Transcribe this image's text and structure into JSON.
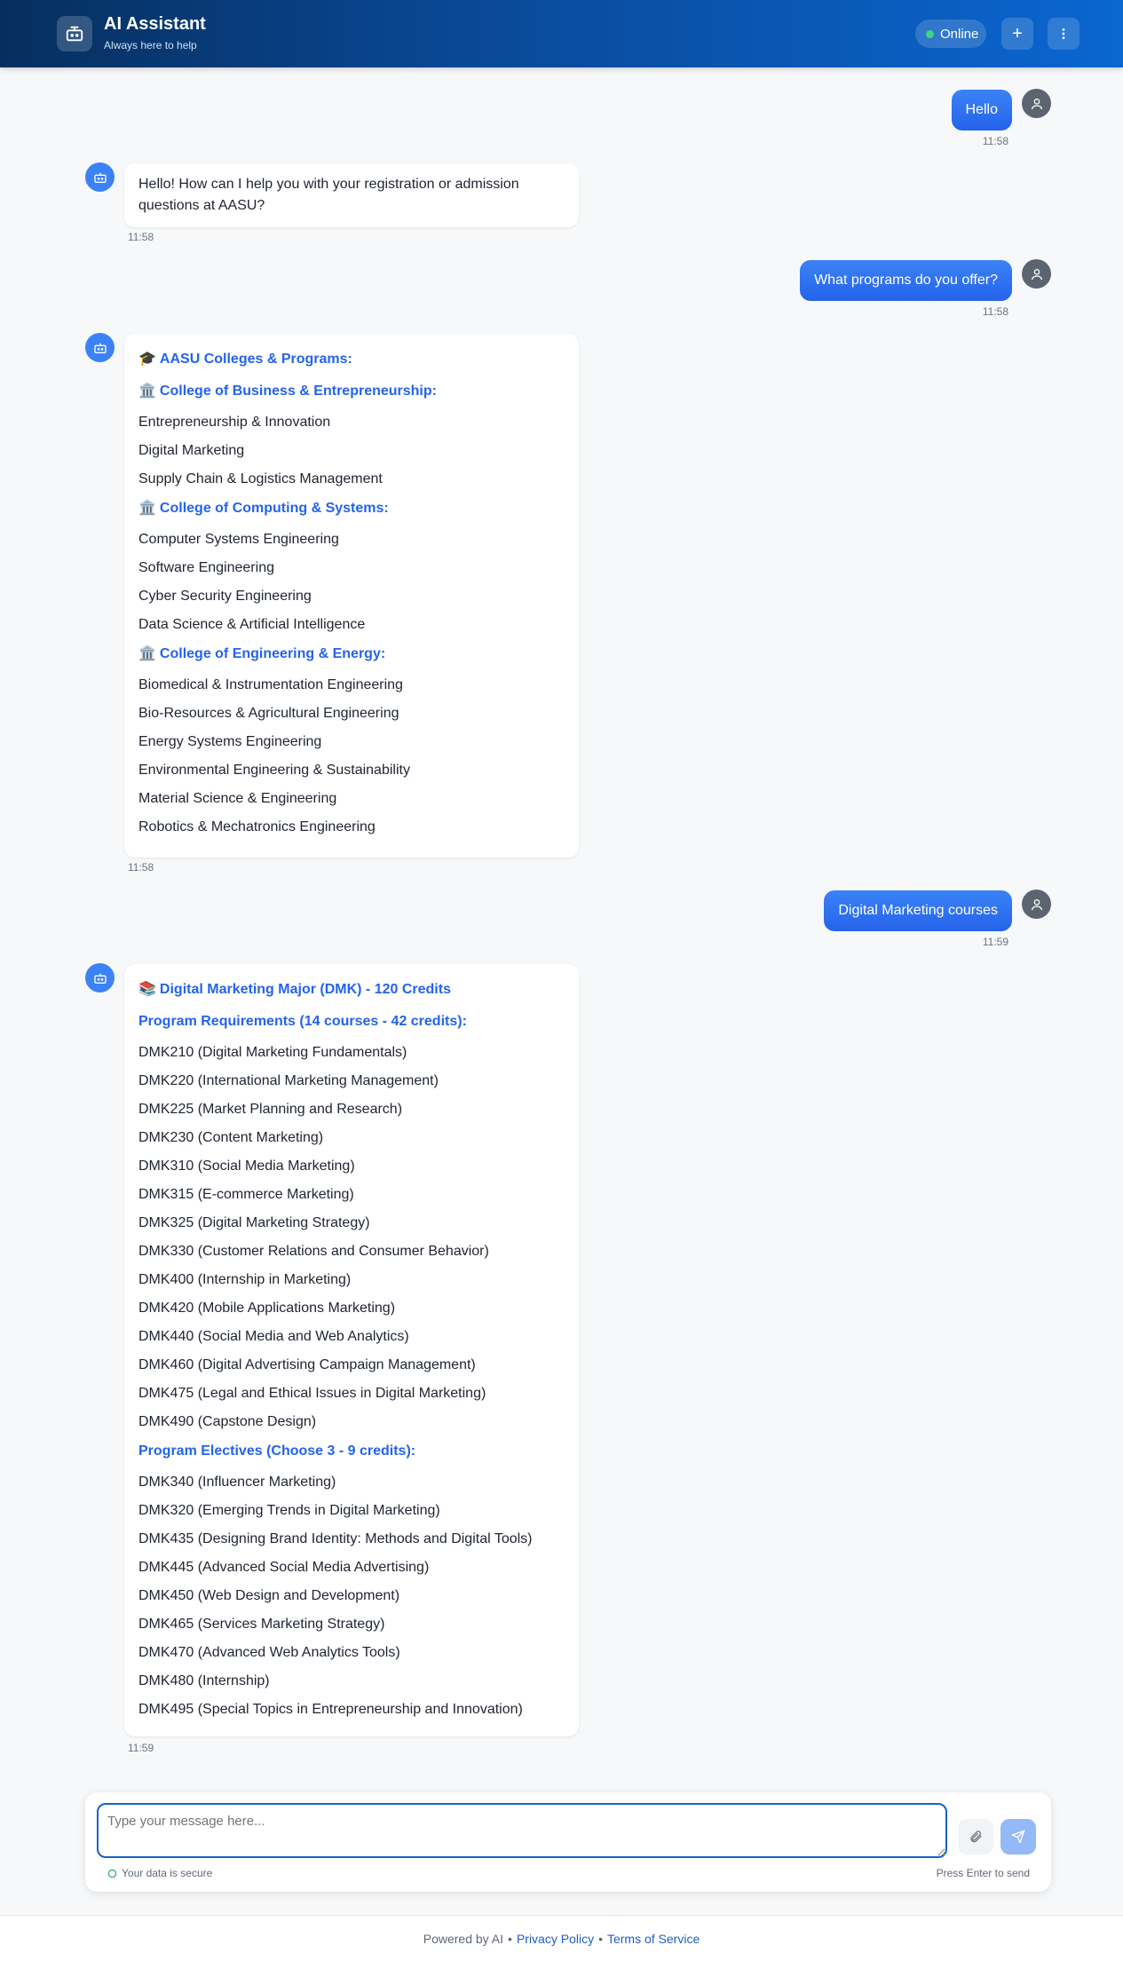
{
  "header": {
    "title": "AI Assistant",
    "subtitle": "Always here to help",
    "status": "Online",
    "new_chat_icon": "plus-icon",
    "menu_icon": "more-vertical-icon"
  },
  "messages": [
    {
      "role": "user",
      "text": "Hello",
      "time": "11:58"
    },
    {
      "role": "bot",
      "text": "Hello! How can I help you with your registration or admission questions at AASU?",
      "time": "11:58"
    },
    {
      "role": "user",
      "text": "What programs do you offer?",
      "time": "11:58"
    },
    {
      "role": "bot",
      "time": "11:58",
      "title": {
        "emoji": "🎓",
        "text": "AASU Colleges & Programs:"
      },
      "sections": [
        {
          "emoji": "🏛️",
          "heading": "College of Business & Entrepreneurship:",
          "items": [
            "Entrepreneurship & Innovation",
            "Digital Marketing",
            "Supply Chain & Logistics Management"
          ]
        },
        {
          "emoji": "🏛️",
          "heading": "College of Computing & Systems:",
          "items": [
            "Computer Systems Engineering",
            "Software Engineering",
            "Cyber Security Engineering",
            "Data Science & Artificial Intelligence"
          ]
        },
        {
          "emoji": "🏛️",
          "heading": "College of Engineering & Energy:",
          "items": [
            "Biomedical & Instrumentation Engineering",
            "Bio-Resources & Agricultural Engineering",
            "Energy Systems Engineering",
            "Environmental Engineering & Sustainability",
            "Material Science & Engineering",
            "Robotics & Mechatronics Engineering"
          ]
        }
      ]
    },
    {
      "role": "user",
      "text": "Digital Marketing courses",
      "time": "11:59"
    },
    {
      "role": "bot",
      "time": "11:59",
      "title": {
        "emoji": "📚",
        "text": "Digital Marketing Major (DMK) - 120 Credits"
      },
      "sections": [
        {
          "emoji": "",
          "heading": "Program Requirements (14 courses - 42 credits):",
          "items": [
            "DMK210 (Digital Marketing Fundamentals)",
            "DMK220 (International Marketing Management)",
            "DMK225 (Market Planning and Research)",
            "DMK230 (Content Marketing)",
            "DMK310 (Social Media Marketing)",
            "DMK315 (E-commerce Marketing)",
            "DMK325 (Digital Marketing Strategy)",
            "DMK330 (Customer Relations and Consumer Behavior)",
            "DMK400 (Internship in Marketing)",
            "DMK420 (Mobile Applications Marketing)",
            "DMK440 (Social Media and Web Analytics)",
            "DMK460 (Digital Advertising Campaign Management)",
            "DMK475 (Legal and Ethical Issues in Digital Marketing)",
            "DMK490 (Capstone Design)"
          ]
        },
        {
          "emoji": "",
          "heading": "Program Electives (Choose 3 - 9 credits):",
          "items": [
            "DMK340 (Influencer Marketing)",
            "DMK320 (Emerging Trends in Digital Marketing)",
            "DMK435 (Designing Brand Identity: Methods and Digital Tools)",
            "DMK445 (Advanced Social Media Advertising)",
            "DMK450 (Web Design and Development)",
            "DMK465 (Services Marketing Strategy)",
            "DMK470 (Advanced Web Analytics Tools)",
            "DMK480 (Internship)",
            "DMK495 (Special Topics in Entrepreneurship and Innovation)"
          ]
        }
      ]
    }
  ],
  "composer": {
    "placeholder": "Type your message here...",
    "secure_note": "Your data is secure",
    "hint": "Press Enter to send",
    "attach_icon": "paperclip-icon",
    "send_icon": "send-icon"
  },
  "footer": {
    "powered": "Powered by AI",
    "sep": "•",
    "privacy": "Privacy Policy",
    "terms": "Terms of Service"
  },
  "colors": {
    "header_start": "#062f5e",
    "header_end": "#0a66d1",
    "user_bubble": "#2563eb",
    "bot_heading": "#2563eb",
    "online_dot": "#3cd28a"
  }
}
